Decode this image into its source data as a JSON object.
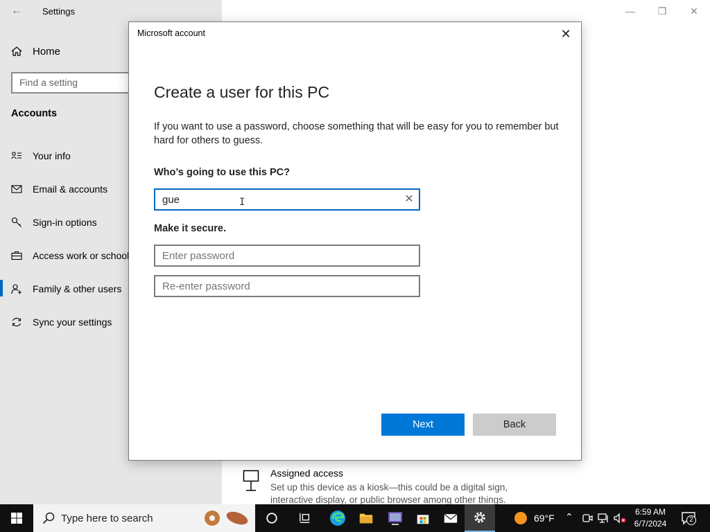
{
  "settings": {
    "window_title": "Settings",
    "home_label": "Home",
    "search_placeholder": "Find a setting",
    "section_title": "Accounts",
    "nav_items": [
      {
        "label": "Your info",
        "icon": "contact-card-icon"
      },
      {
        "label": "Email & accounts",
        "icon": "mail-icon"
      },
      {
        "label": "Sign-in options",
        "icon": "key-icon"
      },
      {
        "label": "Access work or school",
        "icon": "briefcase-icon"
      },
      {
        "label": "Family & other users",
        "icon": "person-add-icon",
        "selected": true
      },
      {
        "label": "Sync your settings",
        "icon": "sync-icon"
      }
    ],
    "assigned_access": {
      "title": "Assigned access",
      "description": "Set up this device as a kiosk—this could be a digital sign, interactive display, or public browser among other things."
    }
  },
  "dialog": {
    "title": "Microsoft account",
    "heading": "Create a user for this PC",
    "description": "If you want to use a password, choose something that will be easy for you to remember but hard for others to guess.",
    "who_label": "Who’s going to use this PC?",
    "username_value": "gue",
    "secure_label": "Make it secure.",
    "password_placeholder": "Enter password",
    "reenter_placeholder": "Re-enter password",
    "next_label": "Next",
    "back_label": "Back"
  },
  "taskbar": {
    "search_placeholder": "Type here to search",
    "weather": "69°F",
    "time": "6:59 AM",
    "date": "6/7/2024",
    "notification_count": "2"
  },
  "colors": {
    "accent": "#0078d7",
    "focus_border": "#0067c0",
    "sidebar_bg": "#e6e6e6",
    "taskbar_bg": "#101010"
  }
}
